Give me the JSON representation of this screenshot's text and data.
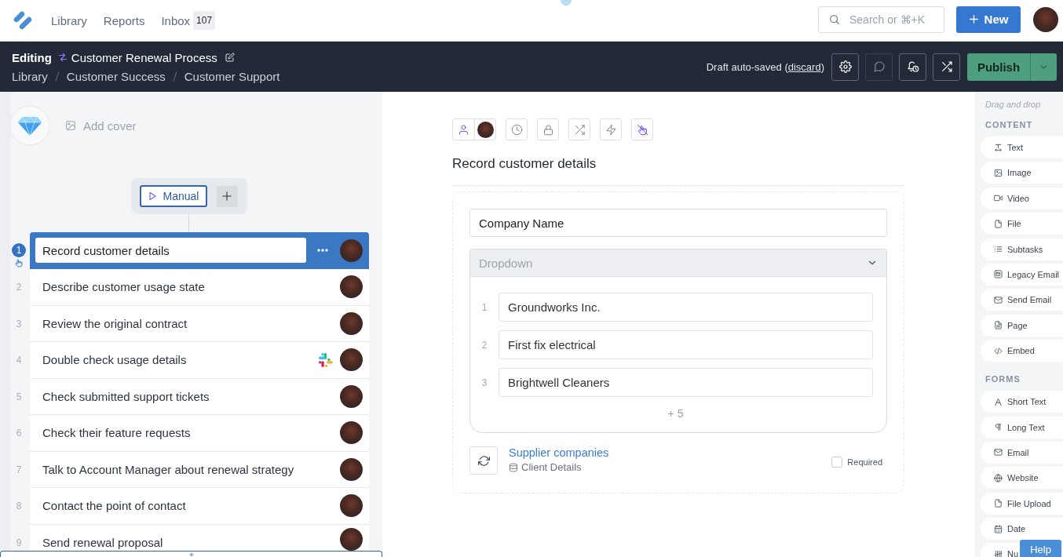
{
  "top_nav": {
    "links": [
      {
        "label": "Library",
        "selected": false
      },
      {
        "label": "Reports",
        "selected": false
      },
      {
        "label": "Inbox",
        "selected": false,
        "badge": "107"
      }
    ],
    "search": {
      "placeholder": "Search or ⌘+K"
    },
    "new_button": "New"
  },
  "editor_bar": {
    "mode": "Editing",
    "title": "Customer Renewal Process",
    "breadcrumbs": [
      "Library",
      "Customer Success",
      "Customer Support"
    ],
    "draft_status": "Draft auto-saved (",
    "discard_link": "discard",
    "draft_status_end": ")",
    "actions": [
      {
        "kind": "settings",
        "disabled": false
      },
      {
        "kind": "comment",
        "disabled": true
      },
      {
        "kind": "reminder",
        "disabled": false
      },
      {
        "kind": "shuffle",
        "disabled": false
      }
    ],
    "publish_button": "Publish"
  },
  "sidebar": {
    "cover": "Add cover",
    "trigger": "Manual",
    "tasks": [
      {
        "number": "1",
        "title": "Record customer details",
        "selected": true,
        "app_icon": false
      },
      {
        "number": "2",
        "title": "Describe customer usage state",
        "selected": false,
        "app_icon": false
      },
      {
        "number": "3",
        "title": "Review the original contract",
        "selected": false,
        "app_icon": false
      },
      {
        "number": "4",
        "title": "Double check usage details",
        "selected": false,
        "app_icon": true
      },
      {
        "number": "5",
        "title": "Check submitted support tickets",
        "selected": false,
        "app_icon": false
      },
      {
        "number": "6",
        "title": "Check their feature requests",
        "selected": false,
        "app_icon": false
      },
      {
        "number": "7",
        "title": "Talk to Account Manager about renewal strategy",
        "selected": false,
        "app_icon": false
      },
      {
        "number": "8",
        "title": "Contact the point of contact",
        "selected": false,
        "app_icon": false
      },
      {
        "number": "9",
        "title": "Send renewal proposal",
        "selected": false,
        "app_icon": false
      }
    ]
  },
  "step": {
    "toolbar": [
      {
        "kind": "assignee",
        "active": true
      },
      {
        "kind": "clock",
        "active": false
      },
      {
        "kind": "lock",
        "active": false
      },
      {
        "kind": "shuffle",
        "active": false
      },
      {
        "kind": "lightning",
        "active": false
      },
      {
        "kind": "hand",
        "active": true
      }
    ],
    "title": "Record customer details",
    "form": {
      "text_field": {
        "value": "Company Name"
      },
      "dropdown": {
        "placeholder": "Dropdown",
        "options": [
          {
            "number": "1",
            "value": "Groundworks Inc."
          },
          {
            "number": "2",
            "value": "First fix electrical"
          },
          {
            "number": "3",
            "value": "Brightwell Cleaners"
          }
        ],
        "more": "+ 5"
      },
      "data_source": {
        "title": "Supplier companies",
        "subtitle": "Client Details"
      },
      "required": {
        "label": "Required",
        "checked": false
      }
    }
  },
  "palette": {
    "hint": "Drag and drop",
    "sections": [
      {
        "title": "CONTENT",
        "items": [
          {
            "label": "Text",
            "kind": "text"
          },
          {
            "label": "Image",
            "kind": "image"
          },
          {
            "label": "Video",
            "kind": "video"
          },
          {
            "label": "File",
            "kind": "file"
          },
          {
            "label": "Subtasks",
            "kind": "subtasks"
          },
          {
            "label": "Legacy Email",
            "kind": "legacy"
          },
          {
            "label": "Send Email",
            "kind": "send"
          },
          {
            "label": "Page",
            "kind": "page"
          },
          {
            "label": "Embed",
            "kind": "embed"
          }
        ]
      },
      {
        "title": "FORMS",
        "items": [
          {
            "label": "Short Text",
            "kind": "short"
          },
          {
            "label": "Long Text",
            "kind": "long"
          },
          {
            "label": "Email",
            "kind": "email"
          },
          {
            "label": "Website",
            "kind": "website"
          },
          {
            "label": "File Upload",
            "kind": "upload"
          },
          {
            "label": "Date",
            "kind": "date"
          },
          {
            "label": "Nu",
            "kind": "number"
          }
        ]
      }
    ]
  },
  "help_button": "Help"
}
